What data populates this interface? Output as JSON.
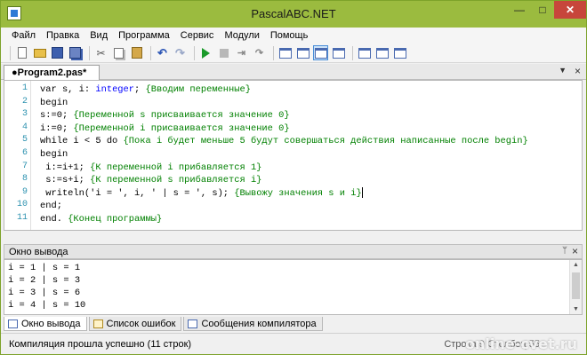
{
  "window": {
    "title": "PascalABC.NET"
  },
  "menu": [
    "Файл",
    "Правка",
    "Вид",
    "Программа",
    "Сервис",
    "Модули",
    "Помощь"
  ],
  "toolbar": {
    "buttons": [
      "new-file-icon",
      "open-folder-icon",
      "save-icon",
      "save-all-icon",
      "cut-icon",
      "copy-icon",
      "paste-icon",
      "undo-icon",
      "redo-icon",
      "run-icon",
      "stop-icon",
      "step-into-icon",
      "step-over-icon",
      "output-window-icon",
      "hide-editor-icon",
      "debug-window-icon"
    ]
  },
  "editor": {
    "tab_title": "●Program2.pas*",
    "lines": [
      {
        "n": "1",
        "parts": [
          [
            "kw",
            "var s, i: "
          ],
          [
            "type",
            "integer"
          ],
          [
            "kw",
            "; "
          ],
          [
            "comment",
            "{Вводим переменные}"
          ]
        ]
      },
      {
        "n": "2",
        "parts": [
          [
            "kw",
            "begin"
          ]
        ]
      },
      {
        "n": "3",
        "parts": [
          [
            "kw",
            "s:=0; "
          ],
          [
            "comment",
            "{Переменной s присваивается значение 0}"
          ]
        ]
      },
      {
        "n": "4",
        "parts": [
          [
            "kw",
            "i:=0; "
          ],
          [
            "comment",
            "{Переменной i присваивается значение 0}"
          ]
        ]
      },
      {
        "n": "5",
        "parts": [
          [
            "kw",
            "while i < 5 do "
          ],
          [
            "comment",
            "{Пока i будет меньше 5 будут совершаться действия написанные после begin}"
          ]
        ]
      },
      {
        "n": "6",
        "parts": [
          [
            "kw",
            "begin"
          ]
        ]
      },
      {
        "n": "7",
        "parts": [
          [
            "kw",
            " i:=i+1; "
          ],
          [
            "comment",
            "{К переменной i прибавляется 1}"
          ]
        ]
      },
      {
        "n": "8",
        "parts": [
          [
            "kw",
            " s:=s+i; "
          ],
          [
            "comment",
            "{К переменной s прибавляется i}"
          ]
        ]
      },
      {
        "n": "9",
        "parts": [
          [
            "kw",
            " writeln("
          ],
          [
            "str",
            "'i = '"
          ],
          [
            "kw",
            ", i, "
          ],
          [
            "str",
            "' | s = '"
          ],
          [
            "kw",
            ", s); "
          ],
          [
            "comment",
            "{Вывожу значения s и i}"
          ]
        ]
      },
      {
        "n": "10",
        "parts": [
          [
            "kw",
            "end;"
          ]
        ]
      },
      {
        "n": "11",
        "parts": [
          [
            "kw",
            "end. "
          ],
          [
            "comment",
            "{Конец программы}"
          ]
        ]
      }
    ]
  },
  "output": {
    "title": "Окно вывода",
    "pin_glyph": "ᛘ",
    "close_glyph": "×",
    "lines": [
      "i = 1 | s = 1",
      "i = 2 | s = 3",
      "i = 3 | s = 6",
      "i = 4 | s = 10"
    ]
  },
  "bottom_tabs": [
    {
      "label": "Окно вывода",
      "icon": "output-window-icon",
      "active": true
    },
    {
      "label": "Список ошибок",
      "icon": "error-list-icon",
      "active": false
    },
    {
      "label": "Сообщения компилятора",
      "icon": "compiler-messages-icon",
      "active": false
    }
  ],
  "status": {
    "message": "Компиляция прошла успешно (11 строк)",
    "position": "Строка 9 Столбец 55",
    "watermark": "online-cvet.ru"
  },
  "controls": {
    "minimize": "—",
    "maximize": "□",
    "close": "✕",
    "tab_dropdown": "▼",
    "tab_close": "×"
  }
}
